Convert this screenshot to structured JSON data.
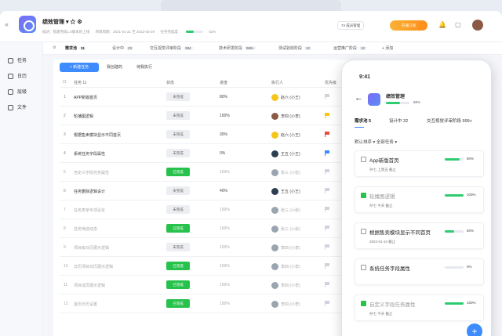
{
  "header": {
    "project_title": "绩效管理",
    "meta": [
      "描述：搭建完成1.0版本的上线",
      "项目周期：2021-01-21 至 2022-03-29",
      "任务完成度"
    ],
    "progress_text": "52%",
    "members_label": "74 成员管理",
    "vip_label": "开通订阅"
  },
  "sidebar": {
    "items": [
      {
        "label": "任务"
      },
      {
        "label": "日历"
      },
      {
        "label": "层级"
      },
      {
        "label": "文件"
      }
    ]
  },
  "tabs": [
    {
      "label": "需求池",
      "count": "11"
    },
    {
      "label": "设计中",
      "count": "23"
    },
    {
      "label": "交互视觉评审阶段",
      "count": "384"
    },
    {
      "label": "技术研发阶段",
      "count": "999+"
    },
    {
      "label": "测试验收阶段",
      "count": "12"
    },
    {
      "label": "运营推广阶段",
      "count": "12"
    },
    {
      "label": "+ 添加",
      "count": ""
    }
  ],
  "toolbar": {
    "new_task": "+ 新建任务",
    "mine": "我创建的",
    "todo": "待我执行"
  },
  "table": {
    "headers": [
      "任务 11",
      "状态",
      "进度",
      "执行人",
      "优先级"
    ],
    "rows": [
      {
        "num": "1",
        "name": "APP新版首页",
        "status": "未完成",
        "pct": "80%",
        "who": "赵六 (小王)",
        "done": false,
        "flag": "#cfd4dc",
        "av": "#f5c518"
      },
      {
        "num": "2",
        "name": "轮播图逻辑",
        "status": "未完成",
        "pct": "100%",
        "who": "李四 (小李)",
        "done": false,
        "flag": "#f5c518",
        "av": "#8a5a44"
      },
      {
        "num": "3",
        "name": "根据售卖模块显示不同首页",
        "status": "未完成",
        "pct": "30%",
        "who": "赵六 (小王)",
        "done": false,
        "flag": "#e74c3c",
        "av": "#f5c518"
      },
      {
        "num": "4",
        "name": "系统任务字段属性",
        "status": "未完成",
        "pct": "0%",
        "who": "王五 (小王)",
        "done": false,
        "flag": "#3d8bfd",
        "av": "#2c3e50"
      },
      {
        "num": "5",
        "name": "自定义字段任务属性",
        "status": "已完成",
        "pct": "100%",
        "who": "张三 (小张)",
        "done": true,
        "flag": "#cfd4dc",
        "av": "#9aa5b1"
      },
      {
        "num": "6",
        "name": "任务删除逻辑设计",
        "status": "未完成",
        "pct": "40%",
        "who": "王五 (小王)",
        "done": false,
        "flag": "#cfd4dc",
        "av": "#2c3e50"
      },
      {
        "num": "7",
        "name": "任务表单专项设定",
        "status": "未完成",
        "pct": "100%",
        "who": "张三 (小张)",
        "done": true,
        "flag": "#cfd4dc",
        "av": "#9aa5b1"
      },
      {
        "num": "8",
        "name": "任务筛选动态",
        "status": "已完成",
        "pct": "100%",
        "who": "张三 (小张)",
        "done": true,
        "flag": "#cfd4dc",
        "av": "#9aa5b1"
      },
      {
        "num": "9",
        "name": "项目级日历展示逻辑",
        "status": "未完成",
        "pct": "100%",
        "who": "李四 (小李)",
        "done": true,
        "flag": "#cfd4dc",
        "av": "#9aa5b1"
      },
      {
        "num": "10",
        "name": "日历项目日历展示逻辑",
        "status": "已完成",
        "pct": "100%",
        "who": "李四 (小李)",
        "done": true,
        "flag": "#cfd4dc",
        "av": "#9aa5b1"
      },
      {
        "num": "11",
        "name": "项目成员展示逻辑",
        "status": "已完成",
        "pct": "100%",
        "who": "李四 (小李)",
        "done": true,
        "flag": "#cfd4dc",
        "av": "#9aa5b1"
      },
      {
        "num": "12",
        "name": "首页日历设置",
        "status": "已完成",
        "pct": "100%",
        "who": "李四 (小李)",
        "done": true,
        "flag": "#cfd4dc",
        "av": "#9aa5b1"
      }
    ]
  },
  "phone": {
    "time": "9:41",
    "title": "绩效管理",
    "progress": "88%",
    "tabs": [
      "需求池 5",
      "设计中 32",
      "交互视觉评审阶段 999+"
    ],
    "filter": "默认排序 ▾   全部任务 ▾",
    "cards": [
      {
        "title": "App新版首页",
        "meta": "孙七   上周五 截止",
        "pct": "80%",
        "fill": 0.8,
        "done": false
      },
      {
        "title": "轮播图逻辑",
        "meta": "孙七   今天 截止",
        "pct": "100%",
        "fill": 1,
        "done": true
      },
      {
        "title": "根据售卖模块显示不同首页",
        "meta": "2022-01-10 截止",
        "pct": "50%",
        "fill": 0.5,
        "done": false
      },
      {
        "title": "系统任务字段属性",
        "meta": "",
        "pct": "0%",
        "fill": 0,
        "done": false
      },
      {
        "title": "自定义字段任务属性",
        "meta": "孙七   今天 截止",
        "pct": "100%",
        "fill": 1,
        "done": true
      }
    ]
  }
}
